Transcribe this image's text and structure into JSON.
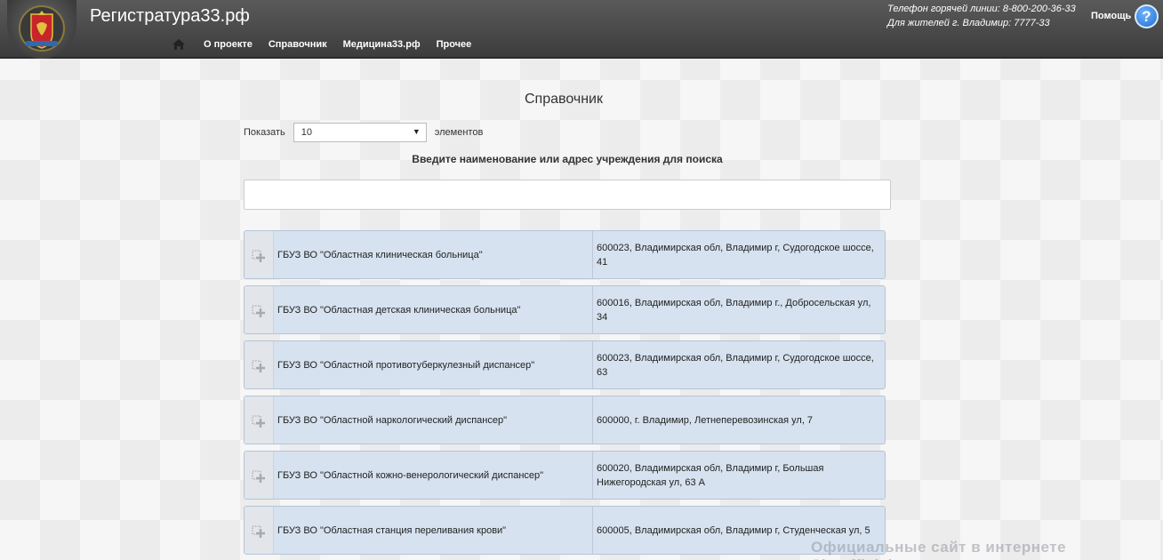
{
  "header": {
    "site_title": "Регистратура33.рф",
    "nav": [
      {
        "label": "О проекте"
      },
      {
        "label": "Справочник"
      },
      {
        "label": "Медицина33.рф"
      },
      {
        "label": "Прочее"
      }
    ],
    "hotline_1": "Телефон горячей линии: 8-800-200-36-33",
    "hotline_2": "Для жителей г. Владимир: 7777-33",
    "help_label": "Помощь",
    "help_icon_glyph": "?"
  },
  "main": {
    "page_title": "Справочник",
    "show_label": "Показать",
    "page_size": "10",
    "items_label": "элементов",
    "search_label": "Введите наименование или адрес учреждения для поиска",
    "search_value": "",
    "search_placeholder": ""
  },
  "institutions": [
    {
      "name": "ГБУЗ ВО \"Областная клиническая больница\"",
      "address": "600023, Владимирская обл, Владимир г, Судогодское шоссе, 41"
    },
    {
      "name": "ГБУЗ ВО \"Областная детская клиническая больница\"",
      "address": "600016, Владимирская обл, Владимир г., Добросельская ул, 34"
    },
    {
      "name": "ГБУЗ ВО \"Областной противотуберкулезный диспансер\"",
      "address": "600023, Владимирская обл, Владимир г, Судогодское шоссе, 63"
    },
    {
      "name": "ГБУЗ ВО \"Областной наркологический диспансер\"",
      "address": "600000, г. Владимир, Летнеперевозинская ул, 7"
    },
    {
      "name": "ГБУЗ ВО \"Областной кожно-венерологический диспансер\"",
      "address": "600020, Владимирская обл, Владимир г, Большая Нижегородская ул, 63 А"
    },
    {
      "name": "ГБУЗ ВО \"Областная станция переливания крови\"",
      "address": "600005, Владимирская обл, Владимир г, Студенческая ул, 5"
    }
  ],
  "watermark": "Официальные сайт в интернете Siteofficial.ru",
  "colors": {
    "header_bg": "#4a4a4a",
    "row_bg": "#d6e2ef",
    "help_blue": "#1f6fd1"
  }
}
